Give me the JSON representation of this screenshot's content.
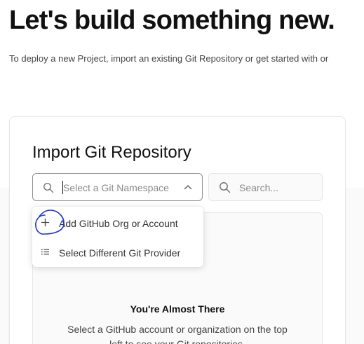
{
  "hero": {
    "title": "Let's build something new.",
    "subtitle": "To deploy a new Project, import an existing Git Repository or get started with or"
  },
  "import_card": {
    "title": "Import Git Repository",
    "namespace_select": {
      "placeholder": "Select a Git Namespace",
      "icon": "search-icon",
      "chevron": "chevron-up-icon"
    },
    "search": {
      "placeholder": "Search...",
      "icon": "search-icon"
    },
    "empty_state": {
      "title": "You're Almost There",
      "description": "Select a GitHub account or organization on the top left to see your Git repositories."
    }
  },
  "dropdown": {
    "items": [
      {
        "label": "Add GitHub Org or Account",
        "icon": "plus-icon"
      },
      {
        "label": "Select Different Git Provider",
        "icon": "list-icon"
      }
    ]
  },
  "colors": {
    "annotation": "#1d35d6",
    "border_active": "#8f8f8f",
    "background": "#fafafa"
  }
}
